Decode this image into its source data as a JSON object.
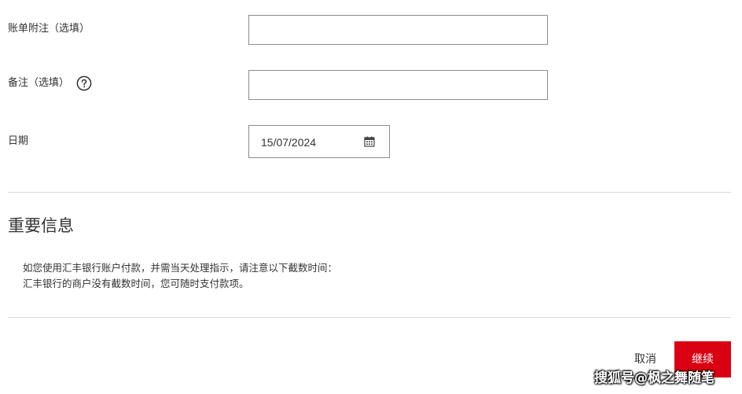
{
  "form": {
    "bill_note_label": "账单附注（选填）",
    "bill_note_value": "",
    "remark_label": "备注（选填）",
    "remark_value": "",
    "date_label": "日期",
    "date_value": "15/07/2024"
  },
  "important": {
    "title": "重要信息",
    "line1": "如您使用汇丰银行账户付款，并需当天处理指示，请注意以下截数时间：",
    "line2": "汇丰银行的商户没有截数时间，您可随时支付款项。"
  },
  "actions": {
    "cancel_label": "取消",
    "continue_label": "继续"
  },
  "watermark": {
    "text": "搜狐号@枫之舞随笔"
  },
  "icons": {
    "help": "question-circle-icon",
    "calendar": "calendar-icon"
  },
  "colors": {
    "primary_button": "#db0011",
    "input_border": "#8c8c8c",
    "divider": "#d9d9d9"
  }
}
